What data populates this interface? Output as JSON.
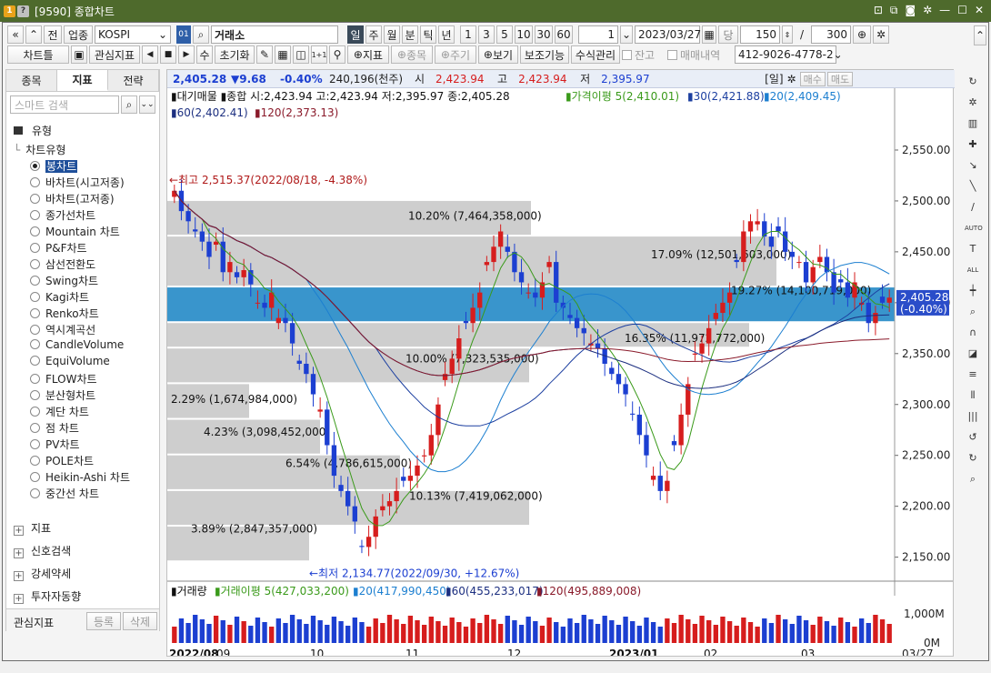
{
  "window": {
    "title": "[9590] 종합차트",
    "icon1": "1",
    "icon2": "?"
  },
  "toolbar1": {
    "nav_prev": "«",
    "nav_up": "»",
    "btn_jeon": "전",
    "market": "업종",
    "symbol": "KOSPI",
    "code_icon": "01",
    "search": "거래소",
    "periods": [
      "일",
      "주",
      "월",
      "분",
      "틱",
      "년"
    ],
    "nums": [
      "1",
      "3",
      "5",
      "10",
      "30",
      "60"
    ],
    "unit": "1",
    "date": "2023/03/27",
    "dang": "당",
    "count": "150",
    "slash": "/",
    "total": "300"
  },
  "toolbar2": {
    "chart_tool": "차트틀",
    "watch": "관심지표",
    "su": "수",
    "reset": "초기화",
    "indicator": "지표",
    "jongmok": "종목",
    "jugi": "주기",
    "view": "보기",
    "aux": "보조기능",
    "formula": "수식관리",
    "janko": "잔고",
    "trade": "매매내역",
    "account": "412-9026-4778-2"
  },
  "left": {
    "tabs": [
      "종목",
      "지표",
      "전략"
    ],
    "search_placeholder": "스마트 검색",
    "type_label": "유형",
    "group_label": "차트유형",
    "items": [
      "봉차트",
      "바차트(시고저종)",
      "바차트(고저종)",
      "종가선차트",
      "Mountain 차트",
      "P&F차트",
      "삼선전환도",
      "Swing차트",
      "Kagi차트",
      "Renko차트",
      "역시계곡선",
      "CandleVolume",
      "EquiVolume",
      "FLOW차트",
      "분산형차트",
      "계단 차트",
      "점 차트",
      "PV차트",
      "POLE차트",
      "Heikin-Ashi 차트",
      "중간선 차트"
    ],
    "sections": [
      "지표",
      "신호검색",
      "강세약세",
      "투자자동향",
      "관심지표"
    ],
    "footer_label": "관심지표",
    "register": "등록",
    "delete": "삭제"
  },
  "info": {
    "price": "2,405.28",
    "change": "▼9.68",
    "pct": "-0.40%",
    "volume": "240,196(천주)",
    "open_lbl": "시",
    "open": "2,423.94",
    "high_lbl": "고",
    "high": "2,423.94",
    "low_lbl": "저",
    "low": "2,395.97",
    "period": "[일]",
    "buy": "매수",
    "sell": "매도"
  },
  "legend": {
    "l1": "▮대기매물 ▮종합 시:2,423.94 고:2,423.94 저:2,395.97 종:2,405.28",
    "ma5": "▮가격이평 5(2,410.01)",
    "ma30": "▮30(2,421.88)",
    "ma20": "▮20(2,409.45)",
    "ma60": "▮60(2,402.41)",
    "ma120": "▮120(2,373.13)"
  },
  "vol_legend": {
    "vol": "▮거래량",
    "ma5": "▮거래이평 5(427,033,200)",
    "ma20": "▮20(417,990,450)",
    "ma60": "▮60(455,233,017)",
    "ma120": "▮120(495,889,008)"
  },
  "chart_data": {
    "type": "candlestick",
    "y_ticks": [
      "2,550.00",
      "2,500.00",
      "2,450.00",
      "2,400.00",
      "2,350.00",
      "2,300.00",
      "2,250.00",
      "2,200.00",
      "2,150.00"
    ],
    "x_ticks": [
      "2022/08",
      "09",
      "10",
      "11",
      "12",
      "2023/01",
      "02",
      "03"
    ],
    "x_end": "03/27",
    "vol_ticks": [
      "1,000M",
      "0M"
    ],
    "last_price": "2,405.28",
    "last_pct": "(-0.40%)",
    "max_annot": "←최고 2,515.37(2022/08/18, -4.38%)",
    "min_annot": "←최저 2,134.77(2022/09/30, +12.67%)",
    "supply": [
      {
        "label": "10.20% (7,464,358,000)"
      },
      {
        "label": "17.09% (12,501,603,000)"
      },
      {
        "label": "19.27% (14,100,719,000)"
      },
      {
        "label": "16.35% (11,972,772,000)"
      },
      {
        "label": "10.00% (7,323,535,000)"
      },
      {
        "label": "2.29% (1,674,984,000)"
      },
      {
        "label": "4.23% (3,098,452,000)"
      },
      {
        "label": "6.54% (4,786,615,000)"
      },
      {
        "label": "10.13% (7,419,062,000)"
      },
      {
        "label": "3.89% (2,847,357,000)"
      }
    ],
    "closes": [
      2510,
      2490,
      2480,
      2470,
      2460,
      2445,
      2460,
      2430,
      2440,
      2425,
      2432,
      2418,
      2400,
      2395,
      2410,
      2385,
      2380,
      2360,
      2340,
      2330,
      2310,
      2295,
      2260,
      2230,
      2215,
      2200,
      2185,
      2160,
      2170,
      2190,
      2200,
      2205,
      2215,
      2225,
      2230,
      2240,
      2250,
      2270,
      2300,
      2330,
      2345,
      2365,
      2380,
      2395,
      2410,
      2440,
      2455,
      2470,
      2450,
      2430,
      2420,
      2410,
      2405,
      2420,
      2440,
      2400,
      2395,
      2385,
      2375,
      2370,
      2360,
      2355,
      2340,
      2330,
      2320,
      2310,
      2290,
      2270,
      2250,
      2230,
      2215,
      2225,
      2260,
      2290,
      2320,
      2350,
      2360,
      2375,
      2390,
      2400,
      2410,
      2440,
      2470,
      2480,
      2480,
      2465,
      2455,
      2470,
      2450,
      2445,
      2440,
      2420,
      2435,
      2445,
      2430,
      2410,
      2420,
      2405,
      2420,
      2400,
      2380,
      2390,
      2400,
      2405
    ]
  },
  "colors": {
    "title_bg": "#4e6a2c",
    "up": "#d61d1d",
    "down": "#1c3fd1",
    "band_blue": "#2e8fc9",
    "band_gray": "#c9c9c9"
  }
}
